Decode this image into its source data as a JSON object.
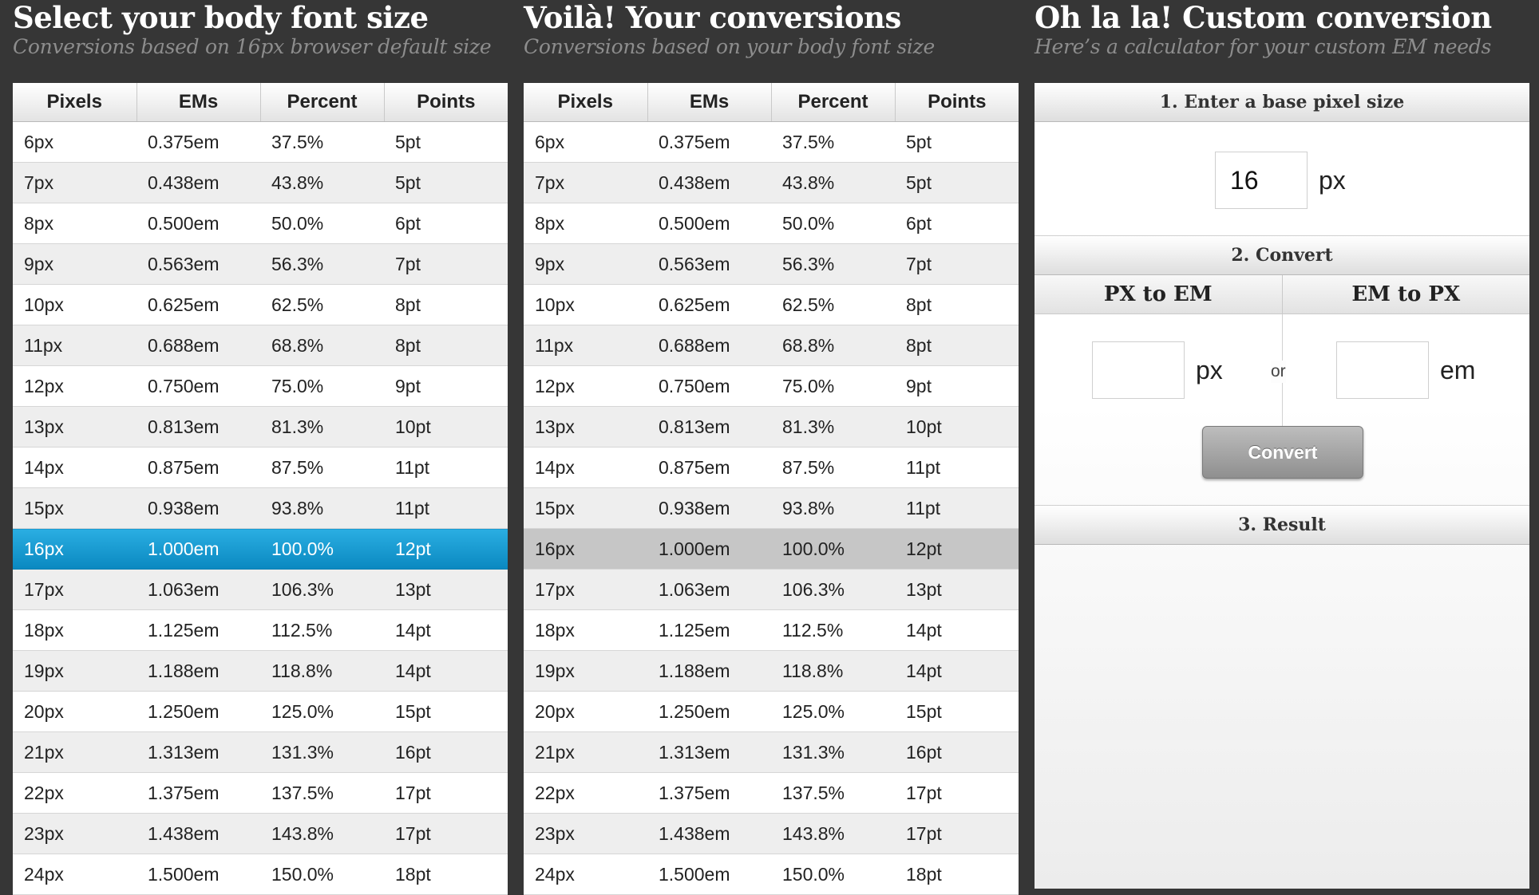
{
  "select": {
    "title": "Select your body font size",
    "subtitle": "Conversions based on 16px browser default size"
  },
  "conversions": {
    "title": "Voilà! Your conversions",
    "subtitle": "Conversions based on your body font size"
  },
  "custom": {
    "title": "Oh la la! Custom conversion",
    "subtitle": "Here’s a calculator for your custom EM needs",
    "step1": "1. Enter a base pixel size",
    "base_value": "16",
    "px_unit": "px",
    "step2": "2. Convert",
    "tab_px_to_em": "PX to EM",
    "tab_em_to_px": "EM to PX",
    "px_input_value": "",
    "em_input_value": "",
    "px_label": "px",
    "or_label": "or",
    "em_label": "em",
    "convert_label": "Convert",
    "step3": "3. Result"
  },
  "table": {
    "headers": [
      "Pixels",
      "EMs",
      "Percent",
      "Points"
    ],
    "selected_index": 10,
    "rows": [
      [
        "6px",
        "0.375em",
        "37.5%",
        "5pt"
      ],
      [
        "7px",
        "0.438em",
        "43.8%",
        "5pt"
      ],
      [
        "8px",
        "0.500em",
        "50.0%",
        "6pt"
      ],
      [
        "9px",
        "0.563em",
        "56.3%",
        "7pt"
      ],
      [
        "10px",
        "0.625em",
        "62.5%",
        "8pt"
      ],
      [
        "11px",
        "0.688em",
        "68.8%",
        "8pt"
      ],
      [
        "12px",
        "0.750em",
        "75.0%",
        "9pt"
      ],
      [
        "13px",
        "0.813em",
        "81.3%",
        "10pt"
      ],
      [
        "14px",
        "0.875em",
        "87.5%",
        "11pt"
      ],
      [
        "15px",
        "0.938em",
        "93.8%",
        "11pt"
      ],
      [
        "16px",
        "1.000em",
        "100.0%",
        "12pt"
      ],
      [
        "17px",
        "1.063em",
        "106.3%",
        "13pt"
      ],
      [
        "18px",
        "1.125em",
        "112.5%",
        "14pt"
      ],
      [
        "19px",
        "1.188em",
        "118.8%",
        "14pt"
      ],
      [
        "20px",
        "1.250em",
        "125.0%",
        "15pt"
      ],
      [
        "21px",
        "1.313em",
        "131.3%",
        "16pt"
      ],
      [
        "22px",
        "1.375em",
        "137.5%",
        "17pt"
      ],
      [
        "23px",
        "1.438em",
        "143.8%",
        "17pt"
      ],
      [
        "24px",
        "1.500em",
        "150.0%",
        "18pt"
      ]
    ]
  }
}
